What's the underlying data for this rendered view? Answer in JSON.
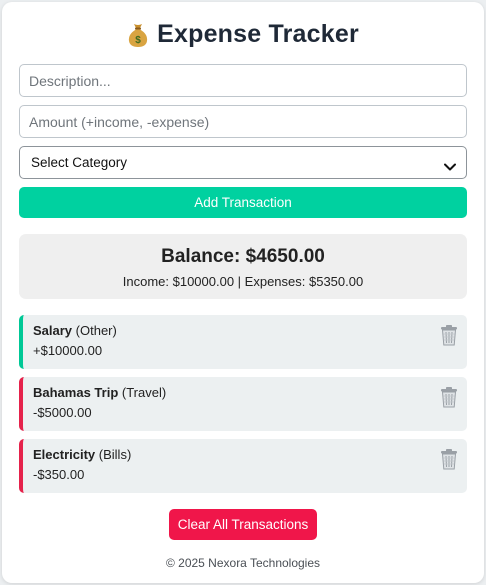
{
  "app": {
    "title": "Expense Tracker",
    "title_icon": "money-bag-icon"
  },
  "form": {
    "description_placeholder": "Description...",
    "amount_placeholder": "Amount (+income, -expense)",
    "category_selected": "Select Category",
    "add_button": "Add Transaction"
  },
  "summary": {
    "balance": "Balance: $4650.00",
    "totals": "Income: $10000.00 | Expenses: $5350.00"
  },
  "transactions": [
    {
      "name": "Salary",
      "category": "(Other)",
      "amount": "+$10000.00",
      "type": "income"
    },
    {
      "name": "Bahamas Trip",
      "category": "(Travel)",
      "amount": "-$5000.00",
      "type": "expense"
    },
    {
      "name": "Electricity",
      "category": "(Bills)",
      "amount": "-$350.00",
      "type": "expense"
    }
  ],
  "actions": {
    "clear_button": "Clear All Transactions"
  },
  "footer": {
    "text": "© 2025 Nexora Technologies"
  },
  "colors": {
    "accent_green": "#00d1a0",
    "income_border": "#00c896",
    "expense_border": "#e5224b",
    "danger_red": "#f0164a"
  },
  "icons": {
    "delete": "trash-can-icon",
    "dropdown": "chevron-down-icon"
  }
}
